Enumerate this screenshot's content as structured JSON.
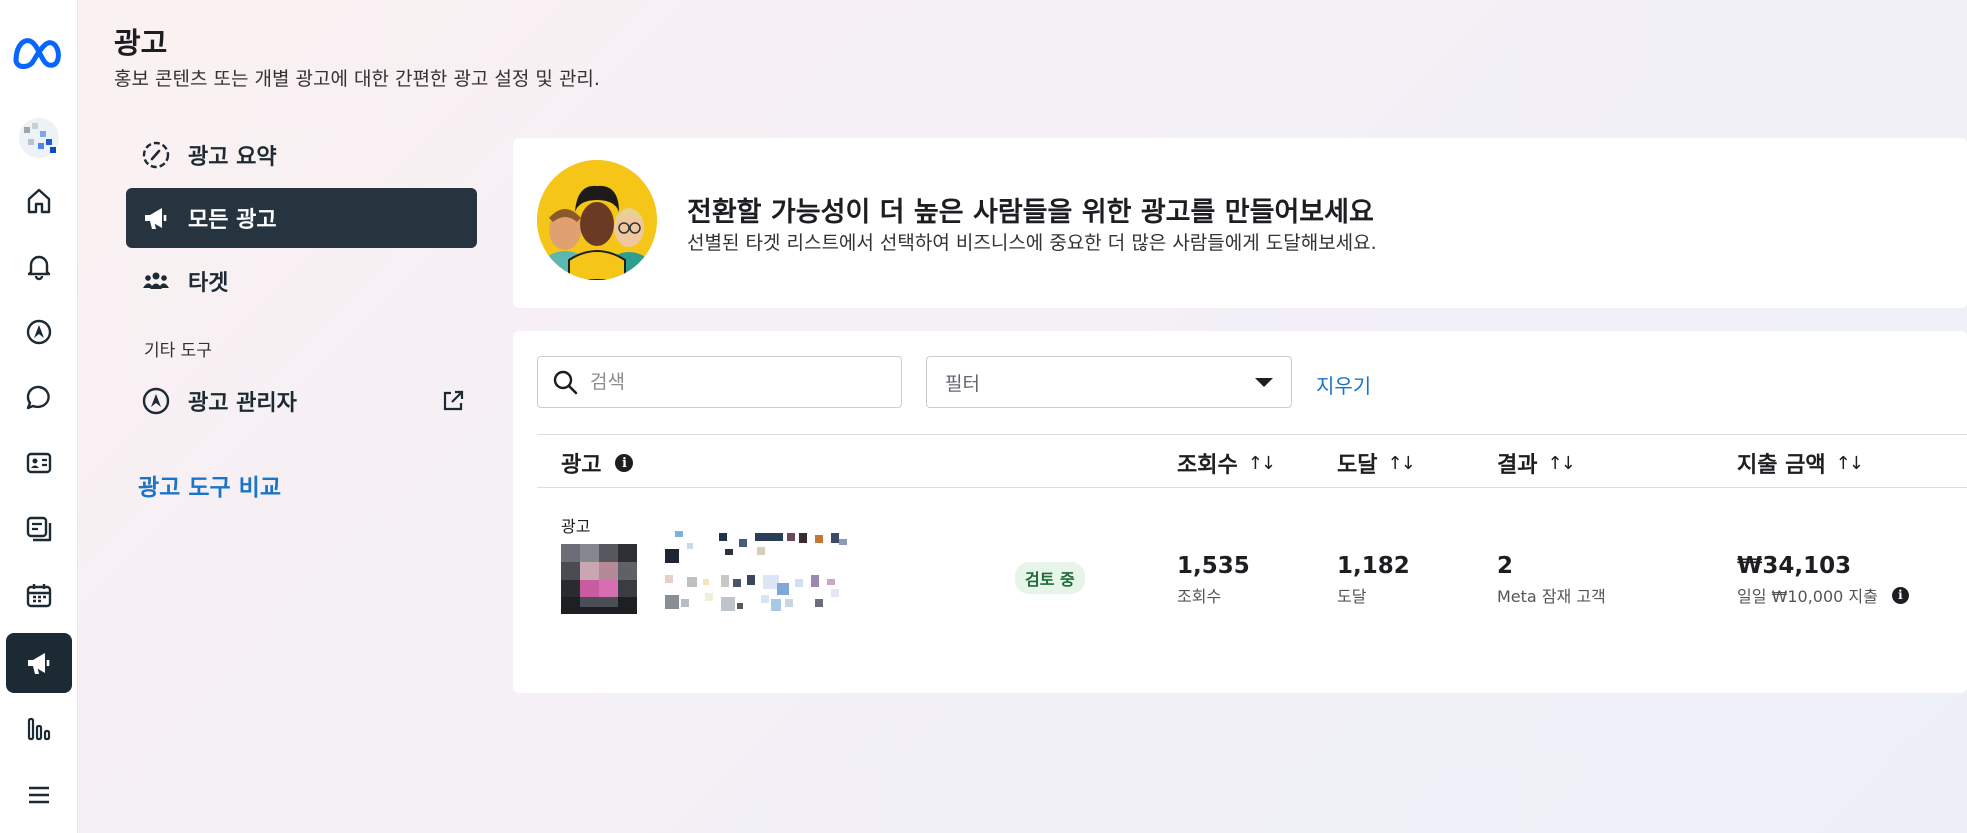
{
  "colors": {
    "brand": "#0866ff",
    "nav_active": "#263440",
    "link": "#1a74c7",
    "badge_bg": "#e6f4ea",
    "badge_fg": "#1e6b3a"
  },
  "rail": {
    "items": [
      {
        "icon": "home-icon",
        "label": "홈"
      },
      {
        "icon": "bell-icon",
        "label": "알림"
      },
      {
        "icon": "ads-manager-icon",
        "label": "광고 관리자"
      },
      {
        "icon": "chat-icon",
        "label": "메시지"
      },
      {
        "icon": "contact-card-icon",
        "label": "연락처"
      },
      {
        "icon": "content-icon",
        "label": "콘텐츠"
      },
      {
        "icon": "calendar-icon",
        "label": "플래너"
      },
      {
        "icon": "megaphone-icon",
        "label": "광고"
      },
      {
        "icon": "insights-icon",
        "label": "인사이트"
      },
      {
        "icon": "menu-icon",
        "label": "메뉴"
      }
    ]
  },
  "header": {
    "title": "광고",
    "subtitle": "홍보 콘텐츠 또는 개별 광고에 대한 간편한 광고 설정 및 관리."
  },
  "nav": {
    "items": [
      {
        "label": "광고 요약",
        "icon": "gauge-icon"
      },
      {
        "label": "모든 광고",
        "icon": "megaphone-icon"
      },
      {
        "label": "타겟",
        "icon": "people-icon"
      }
    ],
    "section_title": "기타 도구",
    "tools": [
      {
        "label": "광고 관리자",
        "icon": "ads-manager-icon"
      }
    ],
    "compare_link": "광고 도구 비교"
  },
  "promo": {
    "title": "전환할 가능성이 더 높은 사람들을 위한 광고를 만들어보세요",
    "subtitle": "선별된 타겟 리스트에서 선택하여 비즈니스에 중요한 더 많은 사람들에게 도달해보세요."
  },
  "table": {
    "search_placeholder": "검색",
    "filter_placeholder": "필터",
    "clear_label": "지우기",
    "columns": [
      {
        "label": "광고",
        "sortable": false
      },
      {
        "label": "조회수",
        "sortable": true
      },
      {
        "label": "도달",
        "sortable": true
      },
      {
        "label": "결과",
        "sortable": true
      },
      {
        "label": "지출 금액",
        "sortable": true
      }
    ],
    "sort_glyph": "↑↓",
    "rows": [
      {
        "type_label": "광고",
        "status": "검토 중",
        "views": "1,535",
        "views_label": "조회수",
        "reach": "1,182",
        "reach_label": "도달",
        "results": "2",
        "results_label": "Meta 잠재 고객",
        "spend": "₩34,103",
        "spend_label": "일일 ₩10,000 지출"
      }
    ]
  }
}
